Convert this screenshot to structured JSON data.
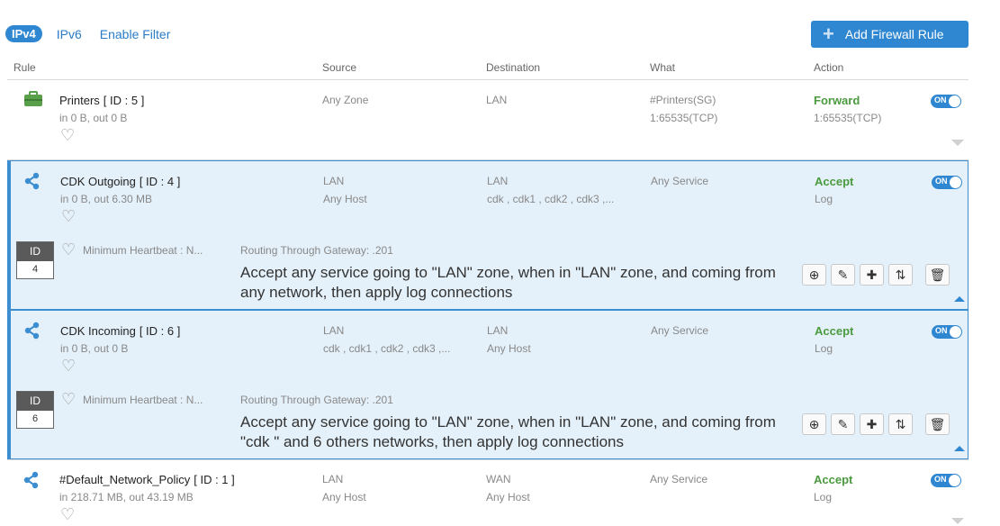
{
  "tabs": {
    "ipv4": "IPv4",
    "ipv6": "IPv6",
    "filter": "Enable Filter"
  },
  "add_button": "Add Firewall Rule",
  "columns": {
    "rule": "Rule",
    "source": "Source",
    "destination": "Destination",
    "what": "What",
    "action": "Action"
  },
  "toggle_label": "ON",
  "id_label": "ID",
  "rules": [
    {
      "name": "Printers",
      "id": "[ ID : 5 ]",
      "traffic": "in 0 B, out 0 B",
      "src1": "Any Zone",
      "src2": "",
      "dst1": "LAN",
      "dst2": "",
      "what1": "#Printers(SG)",
      "what2": "1:65535(TCP)",
      "action1": "Forward",
      "action2": "1:65535(TCP)",
      "icon": "briefcase-icon"
    },
    {
      "name": "CDK Outgoing",
      "id": "[ ID : 4 ]",
      "traffic": "in 0 B, out 6.30 MB",
      "src1": "LAN",
      "src2": "Any Host",
      "dst1": "LAN",
      "dst2": "cdk , cdk1 , cdk2 , cdk3 ,...",
      "what1": "Any Service",
      "action1": "Accept",
      "action2": "Log",
      "heartbeat": "Minimum Heartbeat : N...",
      "routing": "Routing Through Gateway: .201",
      "id_num": "4",
      "description": "Accept any service going to \"LAN\" zone, when in \"LAN\" zone, and coming from any network, then apply log connections",
      "icon": "share-icon"
    },
    {
      "name": "CDK Incoming",
      "id": "[ ID : 6 ]",
      "traffic": "in 0 B, out 0 B",
      "src1": "LAN",
      "src2": "cdk , cdk1 , cdk2 , cdk3 ,...",
      "dst1": "LAN",
      "dst2": "Any Host",
      "what1": "Any Service",
      "action1": "Accept",
      "action2": "Log",
      "heartbeat": "Minimum Heartbeat : N...",
      "routing": "Routing Through Gateway: .201",
      "id_num": "6",
      "description": "Accept any service going to \"LAN\" zone, when in \"LAN\" zone, and coming from \"cdk \" and 6 others networks, then apply log connections",
      "icon": "share-icon"
    },
    {
      "name": "#Default_Network_Policy",
      "id": "[ ID : 1 ]",
      "traffic": "in 218.71 MB, out 43.19 MB",
      "src1": "LAN",
      "src2": "Any Host",
      "dst1": "WAN",
      "dst2": "Any Host",
      "what1": "Any Service",
      "action1": "Accept",
      "action2": "Log",
      "icon": "share-icon"
    }
  ]
}
